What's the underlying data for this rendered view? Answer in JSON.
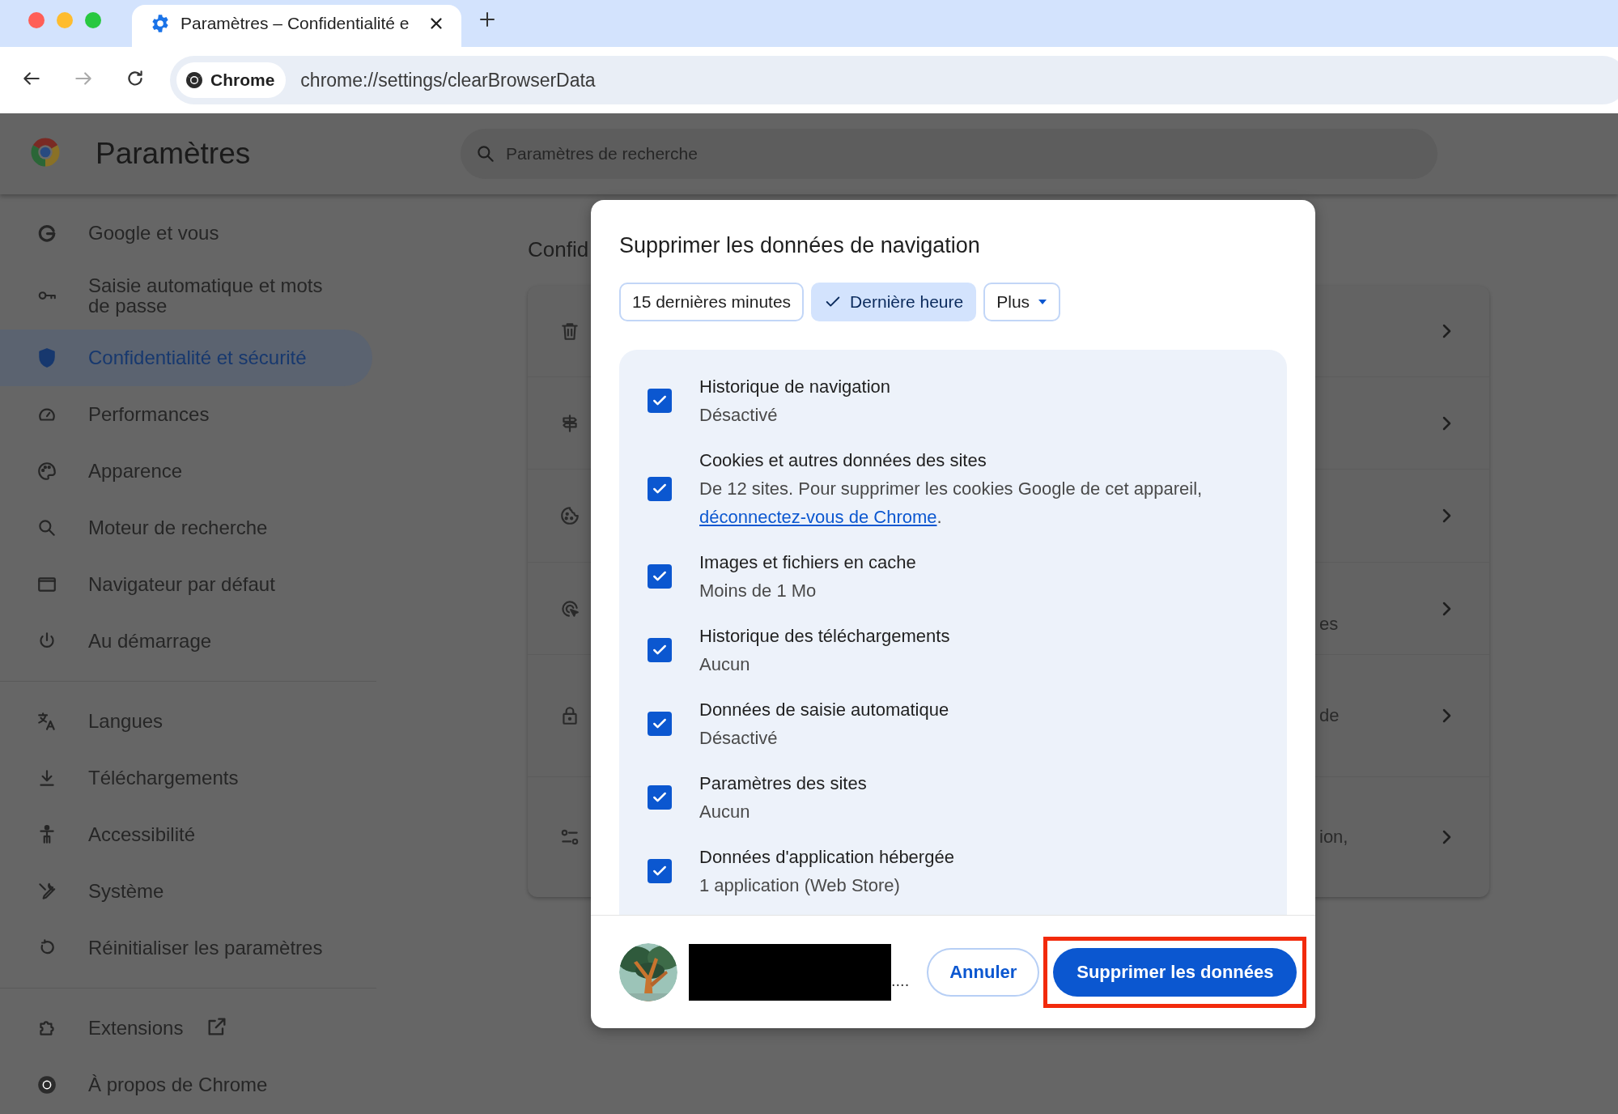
{
  "browser": {
    "tab": {
      "title": "Paramètres – Confidentialité e"
    },
    "site_chip": "Chrome",
    "url": "chrome://settings/clearBrowserData"
  },
  "header": {
    "title": "Paramètres",
    "search": {
      "placeholder": "Paramètres de recherche"
    }
  },
  "sidebar": {
    "groups": [
      {
        "items": [
          {
            "label": "Google et vous",
            "selected": false
          },
          {
            "label": "Saisie automatique et mots de passe",
            "selected": false
          },
          {
            "label": "Confidentialité et sécurité",
            "selected": true
          },
          {
            "label": "Performances",
            "selected": false
          },
          {
            "label": "Apparence",
            "selected": false
          },
          {
            "label": "Moteur de recherche",
            "selected": false
          },
          {
            "label": "Navigateur par défaut",
            "selected": false
          },
          {
            "label": "Au démarrage",
            "selected": false
          }
        ]
      },
      {
        "items": [
          {
            "label": "Langues",
            "selected": false
          },
          {
            "label": "Téléchargements",
            "selected": false
          },
          {
            "label": "Accessibilité",
            "selected": false
          },
          {
            "label": "Système",
            "selected": false
          },
          {
            "label": "Réinitialiser les paramètres",
            "selected": false
          }
        ]
      },
      {
        "items": [
          {
            "label": "Extensions",
            "selected": false,
            "external": true
          },
          {
            "label": "À propos de Chrome",
            "selected": false
          }
        ]
      }
    ]
  },
  "section": {
    "title": "Confid",
    "rows": [
      {
        "kind": "subpage"
      },
      {
        "kind": "subpage"
      },
      {
        "kind": "subpage"
      },
      {
        "kind": "subpage",
        "text": "es"
      },
      {
        "kind": "subpage",
        "text": "de"
      },
      {
        "kind": "subpage",
        "text": "ion,"
      }
    ]
  },
  "dialog": {
    "title": "Supprimer les données de navigation",
    "time_ranges": [
      {
        "kind": "option",
        "label": "15 dernières minutes",
        "selected": false
      },
      {
        "kind": "option",
        "label": "Dernière heure",
        "selected": true
      },
      {
        "kind": "dropdown",
        "label": "Plus",
        "selected": false
      }
    ],
    "items": [
      {
        "title": "Historique de navigation",
        "detail": "Désactivé",
        "checked": true
      },
      {
        "title": "Cookies et autres données des sites",
        "detail": "De 12 sites. Pour supprimer les cookies Google de cet appareil,",
        "link": "déconnectez-vous de Chrome",
        "detail_end": ".",
        "checked": true
      },
      {
        "title": "Images et fichiers en cache",
        "detail": "Moins de 1 Mo",
        "checked": true
      },
      {
        "title": "Historique des téléchargements",
        "detail": "Aucun",
        "checked": true
      },
      {
        "title": "Données de saisie automatique",
        "detail": "Désactivé",
        "checked": true
      },
      {
        "title": "Paramètres des sites",
        "detail": "Aucun",
        "checked": true
      },
      {
        "title": "Données d'application hébergée",
        "detail": "1 application (Web Store)",
        "checked": true
      }
    ],
    "account": {
      "name": "...."
    },
    "buttons": [
      {
        "kind": "secondary",
        "label": "Annuler",
        "highlighted": false
      },
      {
        "kind": "primary",
        "label": "Supprimer les données",
        "highlighted": true
      }
    ]
  }
}
